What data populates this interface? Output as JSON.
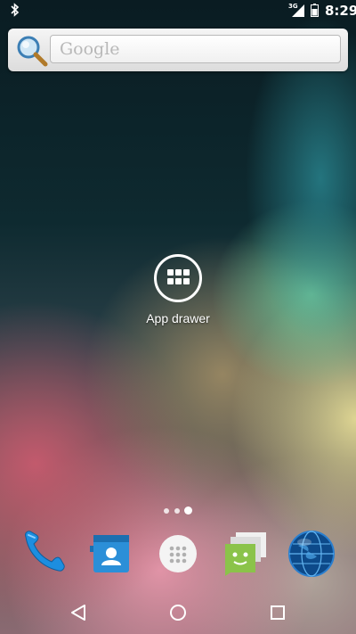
{
  "status_bar": {
    "left_icon": "bluetooth-icon",
    "network_label": "3G",
    "signal_icon": "cell-signal-icon",
    "battery_icon": "battery-icon",
    "time": "8:29"
  },
  "search_widget": {
    "icon": "magnifier-icon",
    "placeholder": "Google"
  },
  "home": {
    "app_drawer_label": "App drawer",
    "page_count": 3,
    "current_page": 3
  },
  "dock": {
    "items": [
      {
        "icon": "phone-icon"
      },
      {
        "icon": "contacts-icon"
      },
      {
        "icon": "all-apps-icon"
      },
      {
        "icon": "messaging-icon"
      },
      {
        "icon": "browser-globe-icon"
      }
    ]
  },
  "navigation": {
    "back_icon": "back-icon",
    "home_icon": "home-icon",
    "recents_icon": "recents-icon"
  },
  "colors": {
    "phone": "#1a8ad8",
    "contacts": "#2a8fd6",
    "messaging": "#8bc34a"
  }
}
